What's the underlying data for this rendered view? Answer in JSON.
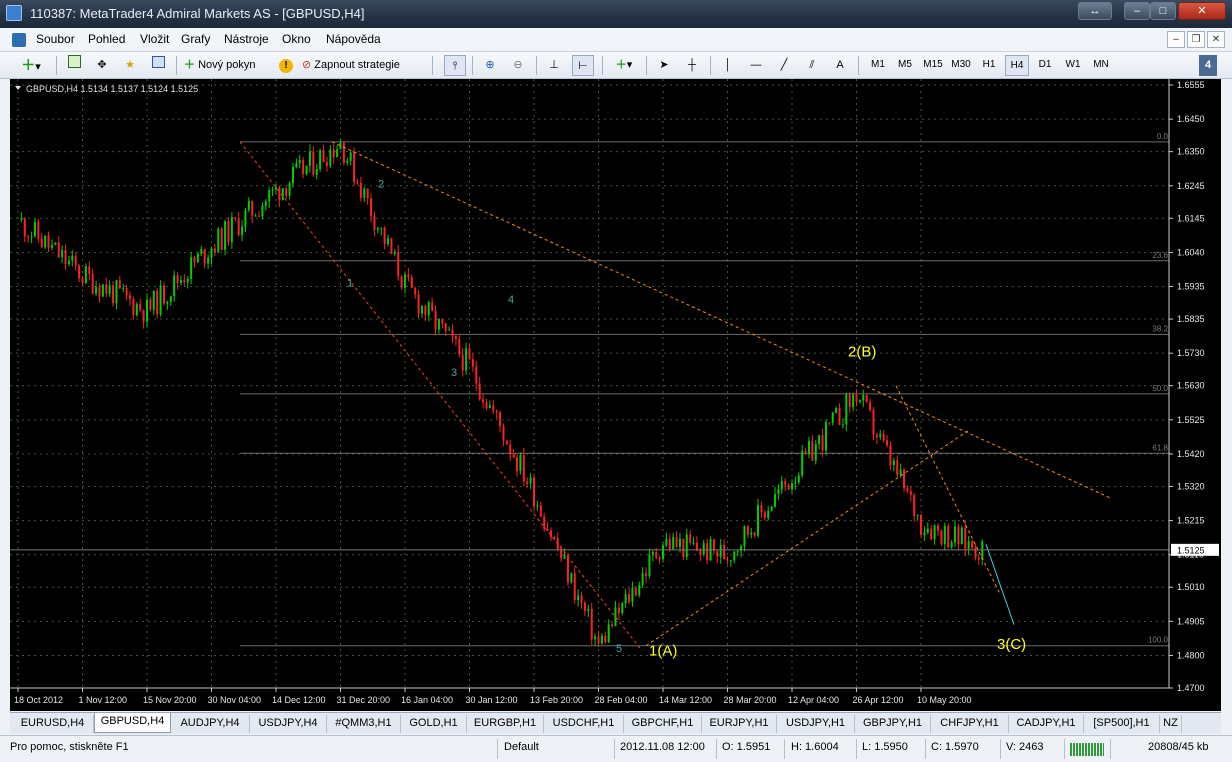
{
  "window": {
    "title": "110387: MetaTrader4 Admiral Markets AS - [GBPUSD,H4]"
  },
  "menu": {
    "items": [
      "Soubor",
      "Pohled",
      "Vložit",
      "Grafy",
      "Nástroje",
      "Okno",
      "Nápověda"
    ]
  },
  "toolbar": {
    "new_order_label": "Nový pokyn",
    "start_strategy_label": "Zapnout strategie",
    "text_tool_label": "A",
    "timeframes": [
      "M1",
      "M5",
      "M15",
      "M30",
      "H1",
      "H4",
      "D1",
      "W1",
      "MN"
    ],
    "active_timeframe": "H4"
  },
  "chart": {
    "header": "GBPUSD,H4  1.5134 1.5137 1.5124 1.5125",
    "price_labels": [
      "1.6555",
      "1.6450",
      "1.6350",
      "1.6245",
      "1.6145",
      "1.6040",
      "1.5935",
      "1.5835",
      "1.5730",
      "1.5630",
      "1.5525",
      "1.5420",
      "1.5320",
      "1.5215",
      "1.5110",
      "1.5010",
      "1.4905",
      "1.4800",
      "1.4700"
    ],
    "current_price": "1.5125",
    "date_labels": [
      "18 Oct 2012",
      "1 Nov 12:00",
      "15 Nov 20:00",
      "30 Nov 04:00",
      "14 Dec 12:00",
      "31 Dec 20:00",
      "16 Jan 04:00",
      "30 Jan 12:00",
      "13 Feb 20:00",
      "28 Feb 04:00",
      "14 Mar 12:00",
      "28 Mar 20:00",
      "12 Apr 04:00",
      "26 Apr 12:00",
      "10 May 20:00"
    ],
    "fib_levels": [
      "0.0",
      "23.6",
      "38.2",
      "50.0",
      "61.8",
      "100.0"
    ],
    "wave_labels_small": [
      "1",
      "2",
      "3",
      "4",
      "5"
    ],
    "wave_labels_big": [
      "1(A)",
      "2(B)",
      "3(C)"
    ],
    "colors": {
      "background": "#000000",
      "bull": "#00d000",
      "bear": "#ff2020",
      "grid": "#3d5a3d",
      "wave_big": "#ffff33",
      "wave_small": "#4aa6a0",
      "trend": "#ff8c00"
    }
  },
  "chart_data": {
    "type": "candlestick",
    "series_name": "GBPUSD,H4",
    "ohlc_last": {
      "open": 1.5134,
      "high": 1.5137,
      "low": 1.5124,
      "close": 1.5125
    },
    "ylim": [
      1.47,
      1.6555
    ],
    "waves": [
      {
        "label": "1(A)",
        "price": 1.483,
        "date": "28 Feb 04:00"
      },
      {
        "label": "2(B)",
        "price": 1.5605,
        "date": "26 Apr 12:00"
      },
      {
        "label": "3(C)",
        "price": 1.489,
        "date": "after 10 May 20:00"
      }
    ],
    "path": [
      [
        "18 Oct 2012",
        1.614
      ],
      [
        "1 Nov 12:00",
        1.597
      ],
      [
        "15 Nov 20:00",
        1.586
      ],
      [
        "30 Nov 04:00",
        1.606
      ],
      [
        "14 Dec 12:00",
        1.623
      ],
      [
        "31 Dec 20:00",
        1.638
      ],
      [
        "16 Jan 04:00",
        1.594
      ],
      [
        "30 Jan 12:00",
        1.569
      ],
      [
        "13 Feb 20:00",
        1.53
      ],
      [
        "28 Feb 04:00",
        1.483
      ],
      [
        "14 Mar 12:00",
        1.515
      ],
      [
        "28 Mar 20:00",
        1.511
      ],
      [
        "12 Apr 04:00",
        1.535
      ],
      [
        "26 Apr 12:00",
        1.5605
      ],
      [
        "10 May 20:00",
        1.521
      ],
      [
        "latest",
        1.5125
      ]
    ]
  },
  "tabs": [
    "EURUSD,H4",
    "GBPUSD,H4",
    "AUDJPY,H4",
    "USDJPY,H4",
    "#QMM3,H1",
    "GOLD,H1",
    "EURGBP,H1",
    "USDCHF,H1",
    "GBPCHF,H1",
    "EURJPY,H1",
    "USDJPY,H1",
    "GBPJPY,H1",
    "CHFJPY,H1",
    "CADJPY,H1",
    "[SP500],H1",
    "NZ"
  ],
  "active_tab": "GBPUSD,H4",
  "status": {
    "help": "Pro pomoc, stiskněte F1",
    "profile": "Default",
    "datetime": "2012.11.08 12:00",
    "open": "O: 1.5951",
    "high": "H: 1.6004",
    "low": "L: 1.5950",
    "close": "C: 1.5970",
    "volume": "V: 2463",
    "traffic": "20808/45 kb"
  }
}
